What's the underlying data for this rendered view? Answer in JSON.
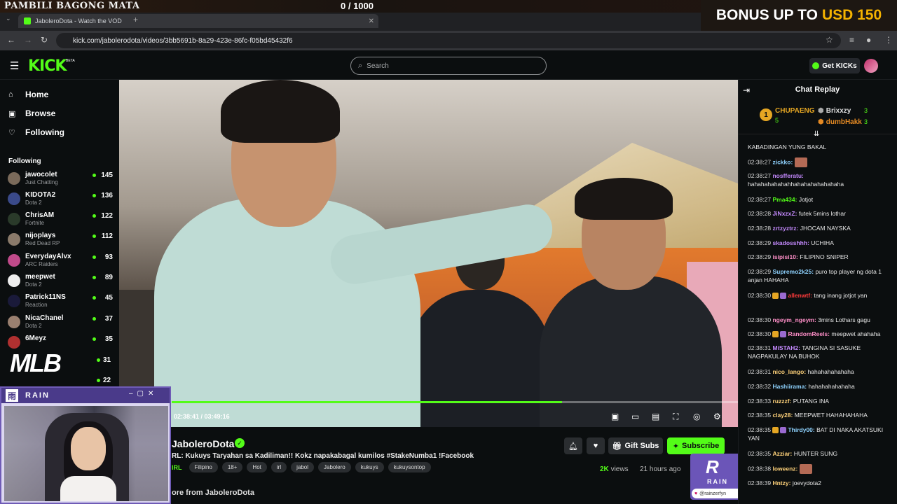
{
  "overlay": {
    "title": "PAMBILI BAGONG MATA",
    "counter": "0   / 1000",
    "bonus_prefix": "BONUS UP TO",
    "bonus_amount": "USD 150"
  },
  "browser": {
    "tab_title": "JaboleroDota - Watch the VOD",
    "url": "kick.com/jabolerodota/videos/3bb5691b-8a29-423e-86fc-f05bd45432f6"
  },
  "header": {
    "logo": "KICK",
    "logo_badge": "BETA",
    "search_placeholder": "Search",
    "get_kicks": "Get KICKs"
  },
  "sidebar": {
    "nav": [
      {
        "label": "Home",
        "icon": "home-icon"
      },
      {
        "label": "Browse",
        "icon": "browse-icon"
      },
      {
        "label": "Following",
        "icon": "heart-icon"
      }
    ],
    "following_title": "Following",
    "channels": [
      {
        "name": "jawocolet",
        "category": "Just Chatting",
        "viewers": "145",
        "color": "#7a6a5a"
      },
      {
        "name": "KIDOTA2",
        "category": "Dota 2",
        "viewers": "136",
        "color": "#3a4a8a"
      },
      {
        "name": "ChrisAM",
        "category": "Fortnite",
        "viewers": "122",
        "color": "#2a3a2a"
      },
      {
        "name": "nijoplays",
        "category": "Red Dead RP",
        "viewers": "112",
        "color": "#8a7a6a"
      },
      {
        "name": "EverydayAlvx",
        "category": "ARC Raiders",
        "viewers": "93",
        "color": "#c04a8a"
      },
      {
        "name": "meepwet",
        "category": "Dota 2",
        "viewers": "89",
        "color": "#eeeeee"
      },
      {
        "name": "Patrick11NS",
        "category": "Reaction",
        "viewers": "45",
        "color": "#1a1a3a"
      },
      {
        "name": "NicaChanel",
        "category": "Dota 2",
        "viewers": "37",
        "color": "#9a8070"
      },
      {
        "name": "6Meyz",
        "category": "",
        "viewers": "35",
        "color": "#b03030"
      }
    ],
    "extra_viewers": [
      "31",
      "22"
    ]
  },
  "stream_overlays": {
    "mlb": "MLB",
    "rain_title": "RAIN",
    "rain_logo": "雨"
  },
  "video": {
    "current_time": "02:38:41",
    "duration": "03:49:16",
    "progress": 0.689
  },
  "vod": {
    "channel": "JaboleroDota",
    "title": "RL: Kukuys Taryahan sa Kadiliman!! Kokz napakabagal kumilos #StakeNumba1 !Facebook",
    "category": "IRL",
    "tags": [
      "Filipino",
      "18+",
      "Hot",
      "irl",
      "jabol",
      "Jabolero",
      "kukuys",
      "kukuysontop"
    ],
    "gift_subs": "Gift Subs",
    "subscribe": "Subscribe",
    "views_count": "2K",
    "views_label": "views",
    "ago": "21 hours ago",
    "about": "ore from JaboleroDota",
    "rain_badge_text": "RAIN",
    "rain_handle": "@rainzerfyn"
  },
  "chat": {
    "title": "Chat Replay",
    "leaders": [
      {
        "rank": "1",
        "name": "CHUPAENG",
        "count": "5"
      },
      {
        "rank": "2",
        "name": "Brixxzy",
        "count": "3"
      },
      {
        "rank": "3",
        "name": "dumbHakk",
        "count": "3"
      }
    ],
    "messages": [
      {
        "time": "",
        "user": "",
        "text": "KABADINGAN YUNG BAKAL",
        "color": "#ffffff"
      },
      {
        "time": "02:38:27",
        "user": "zickko:",
        "text": "",
        "color": "#8fd3ff",
        "emote": true
      },
      {
        "time": "02:38:27",
        "user": "nosfferatu:",
        "text": "hahahahahahahhahahahahahahaha",
        "color": "#c58aff"
      },
      {
        "time": "02:38:27",
        "user": "Pma434:",
        "text": "Jotjot",
        "color": "#53fc18"
      },
      {
        "time": "02:38:28",
        "user": "JiNxzxZ:",
        "text": "futek 5mins lothar",
        "color": "#c58aff"
      },
      {
        "time": "02:38:28",
        "user": "zrtzyztrz:",
        "text": "JHOCAM NAYSKA",
        "color": "#c58aff"
      },
      {
        "time": "02:38:29",
        "user": "skadosshhh:",
        "text": "UCHIHA",
        "color": "#c58aff"
      },
      {
        "time": "02:38:29",
        "user": "isipisi10:",
        "text": "FILIPINO SNIPER",
        "color": "#ff8fc8"
      },
      {
        "time": "02:38:29",
        "user": "Supremo2k25:",
        "text": "puro top player ng dota 1 anjan HAHAHA",
        "color": "#8fd3ff"
      },
      {
        "time": "02:38:30",
        "user": "allenwtf:",
        "text": "tang inang jotjot yan",
        "color": "#ff3b3b",
        "badges": true
      },
      {
        "time": "02:38:30",
        "user": "ngeym_ngeym:",
        "text": "3mins Lothars gagu",
        "color": "#ff8fc8"
      },
      {
        "time": "02:38:30",
        "user": "RandomReels:",
        "text": "meepwet ahahaha",
        "color": "#ff8fc8",
        "badges": true
      },
      {
        "time": "02:38:31",
        "user": "MiSTAH2:",
        "text": "TANGINA SI SASUKE NAGPAKULAY NA BUHOK",
        "color": "#c58aff"
      },
      {
        "time": "02:38:31",
        "user": "nico_lango:",
        "text": "hahahahahahaha",
        "color": "#ffd27a"
      },
      {
        "time": "02:38:32",
        "user": "Hashiirama:",
        "text": "hahahahahahaha",
        "color": "#8fd3ff"
      },
      {
        "time": "02:38:33",
        "user": "ruzzzf:",
        "text": "PUTANG INA",
        "color": "#ffd27a"
      },
      {
        "time": "02:38:35",
        "user": "clay28:",
        "text": "MEEPWET HAHAHAHAHA",
        "color": "#ffd27a"
      },
      {
        "time": "02:38:35",
        "user": "Thirdy00:",
        "text": "BAT DI NAKA AKATSUKI YAN",
        "color": "#8fd3ff",
        "badges": true
      },
      {
        "time": "02:38:35",
        "user": "Azziar:",
        "text": "HUNTER SUNG",
        "color": "#ffd27a"
      },
      {
        "time": "02:38:38",
        "user": "loweenz:",
        "text": "",
        "color": "#ffd27a",
        "emote": true
      },
      {
        "time": "02:38:39",
        "user": "Hntzy:",
        "text": "joevydota2",
        "color": "#ffd27a"
      }
    ]
  }
}
